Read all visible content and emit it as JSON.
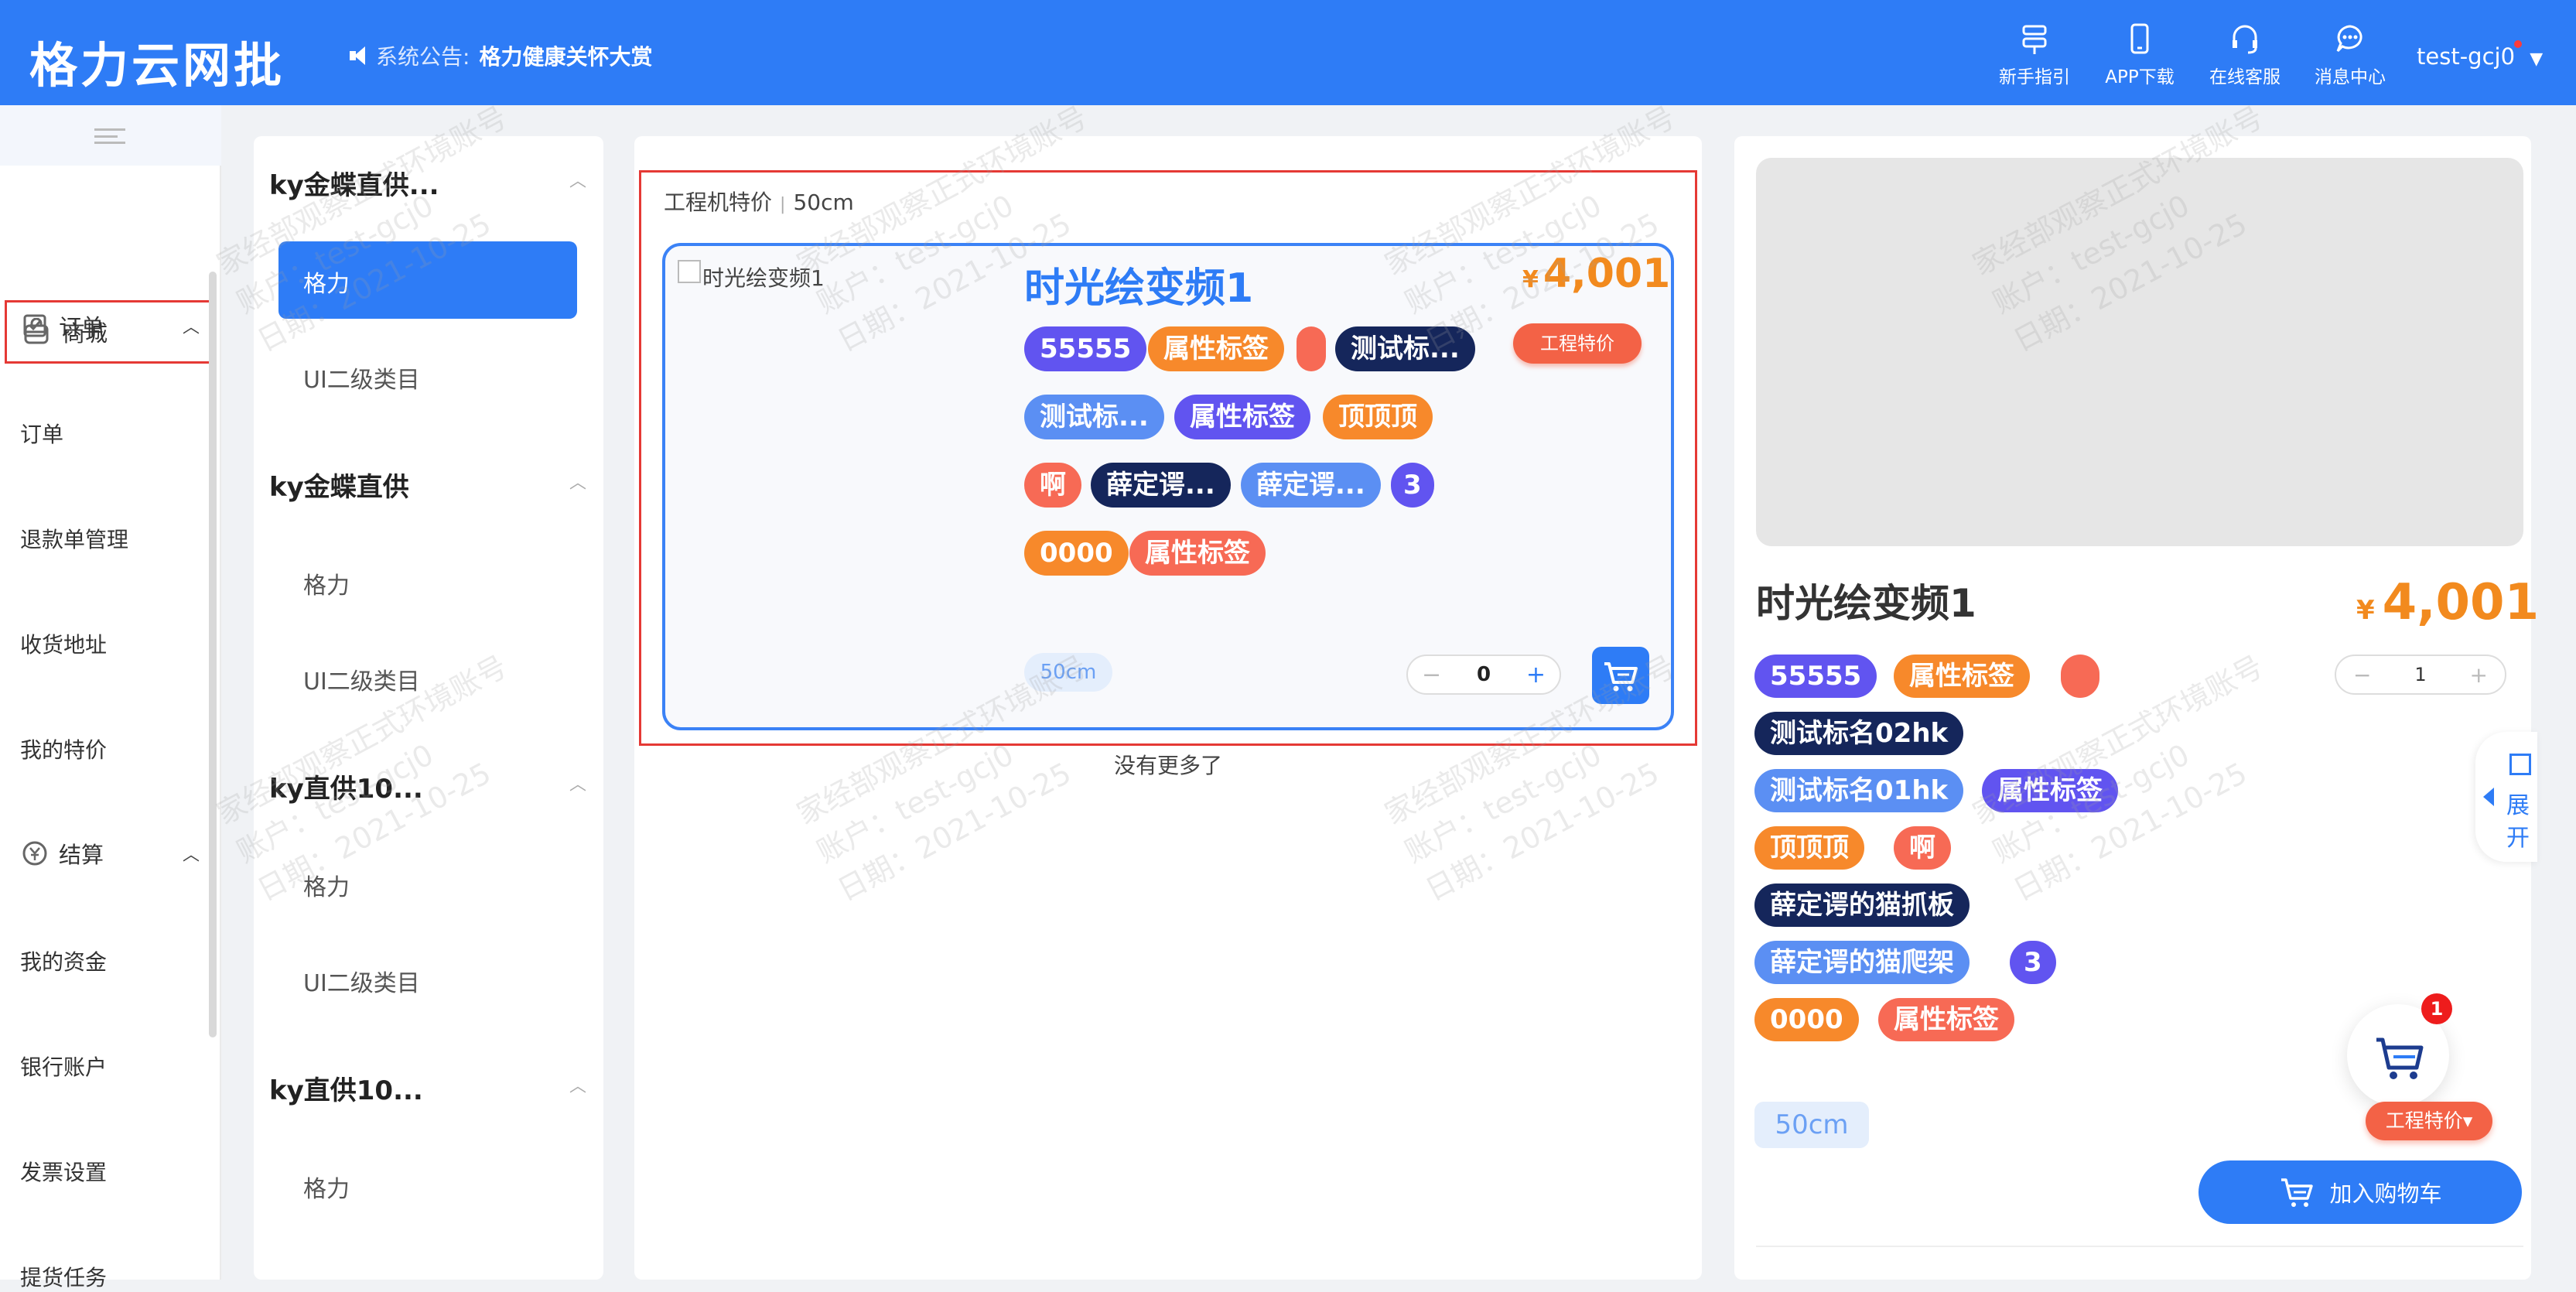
{
  "header": {
    "logo": "格力云网批",
    "notice_prefix": "系统公告:",
    "notice_text": "格力健康关怀大赏",
    "nav": [
      {
        "label": "新手指引",
        "icon": "guide-icon"
      },
      {
        "label": "APP下载",
        "icon": "phone-icon"
      },
      {
        "label": "在线客服",
        "icon": "headset-icon"
      },
      {
        "label": "消息中心",
        "icon": "chat-icon"
      }
    ],
    "user": "test-gcj0"
  },
  "sidebar": {
    "shop": "商城",
    "order_group": "订单",
    "items_a": [
      "订单",
      "退款单管理",
      "收货地址",
      "我的特价"
    ],
    "settle_group": "结算",
    "items_b": [
      "我的资金",
      "银行账户",
      "发票设置",
      "提货任务"
    ]
  },
  "categories": [
    {
      "title": "ky金蝶直供...",
      "subs": [
        "格力",
        "UI二级类目"
      ]
    },
    {
      "title": "ky金蝶直供",
      "subs": [
        "格力",
        "UI二级类目"
      ]
    },
    {
      "title": "ky直供10...",
      "subs": [
        "格力",
        "UI二级类目"
      ]
    },
    {
      "title": "ky直供10...",
      "subs": [
        "格力",
        "UI二级类目"
      ]
    }
  ],
  "product_list": {
    "crumb_a": "工程机特价",
    "crumb_b": "50cm",
    "card": {
      "image_alt": "时光绘变频1",
      "title": "时光绘变频1",
      "currency": "¥",
      "price": "4,001",
      "badge": "工程特价",
      "tags": [
        "55555",
        "属性标签",
        "",
        "测试标...",
        "测试标...",
        "属性标签",
        "顶顶顶",
        "啊",
        "薛定谔...",
        "薛定谔...",
        "3",
        "0000",
        "属性标签"
      ],
      "size": "50cm",
      "qty_minus": "−",
      "qty_value": "0",
      "qty_plus": "+"
    },
    "no_more": "没有更多了"
  },
  "detail": {
    "title": "时光绘变频1",
    "currency": "¥",
    "price": "4,001",
    "qty_minus": "−",
    "qty_value": "1",
    "qty_plus": "+",
    "tags": [
      "55555",
      "属性标签",
      "",
      "测试标名02hk",
      "测试标名01hk",
      "属性标签",
      "顶顶顶",
      "啊",
      "薛定谔的猫抓板",
      "薛定谔的猫爬架",
      "3",
      "0000",
      "属性标签"
    ],
    "size": "50cm",
    "badge": "工程特价▾",
    "add_cart": "加入购物车",
    "cart_count": "1",
    "expand_1": "展",
    "expand_2": "开"
  },
  "watermark": {
    "line1": "家经部观察正式环境账号",
    "line2": "账户：test-gcj0",
    "line3": "日期：2021-10-25"
  },
  "colors": {
    "primary": "#2e7cf6",
    "price": "#f28a1e",
    "tag_purple": "#6154f0",
    "tag_orange": "#f7892b",
    "tag_red": "#f76a55",
    "tag_navy": "#15265b",
    "tag_blue": "#5b8ff3",
    "highlight_box": "#e53935"
  }
}
